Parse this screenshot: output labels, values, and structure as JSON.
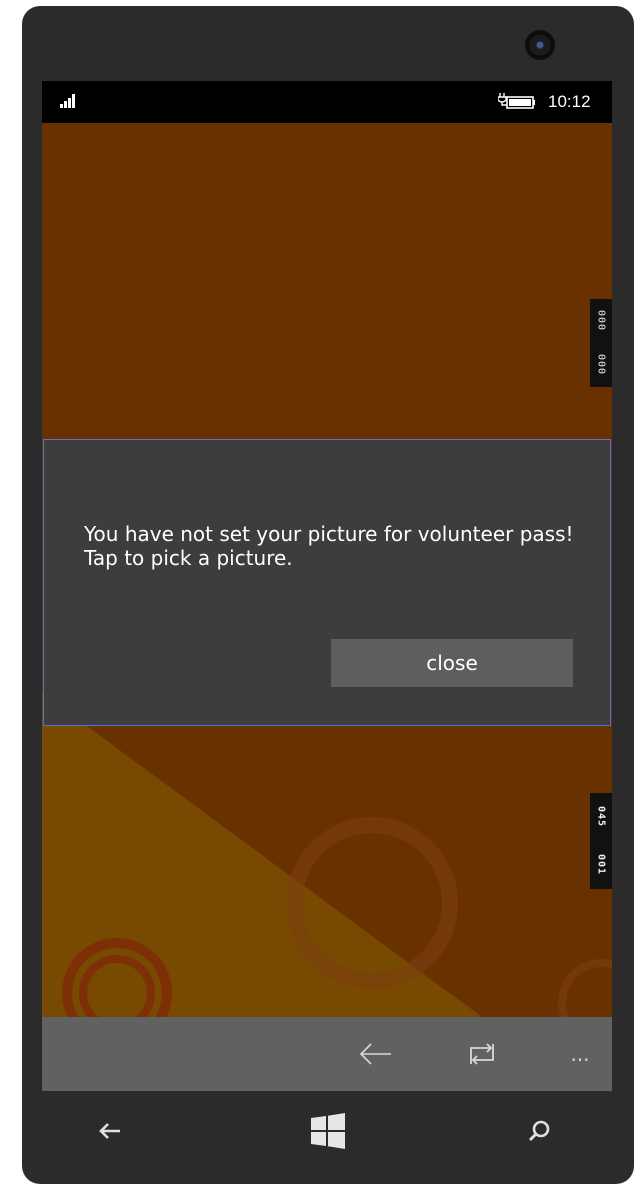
{
  "status_bar": {
    "time": "10:12",
    "signal_icon": "signal-bars-icon",
    "battery_icon": "battery-charging-icon"
  },
  "side_strips": {
    "top": [
      "000",
      "000"
    ],
    "bottom": [
      "045",
      "001"
    ]
  },
  "dialog": {
    "message": "You have not set your picture for volunteer pass! Tap to pick a picture.",
    "close_label": "close"
  },
  "app_bar": {
    "back_icon": "arrow-left-icon",
    "rotate_icon": "rotate-icon",
    "more_label": "..."
  },
  "nav_bar": {
    "back_icon": "back-arrow-icon",
    "start_icon": "windows-logo-icon",
    "search_icon": "search-icon"
  },
  "colors": {
    "background": "#6a3100",
    "dialog": "#3d3d3d",
    "dialog_border": "#5b6fd6",
    "close_button": "#5e5e5e",
    "app_bar": "#616161",
    "phone_frame": "#2b2b2b"
  }
}
